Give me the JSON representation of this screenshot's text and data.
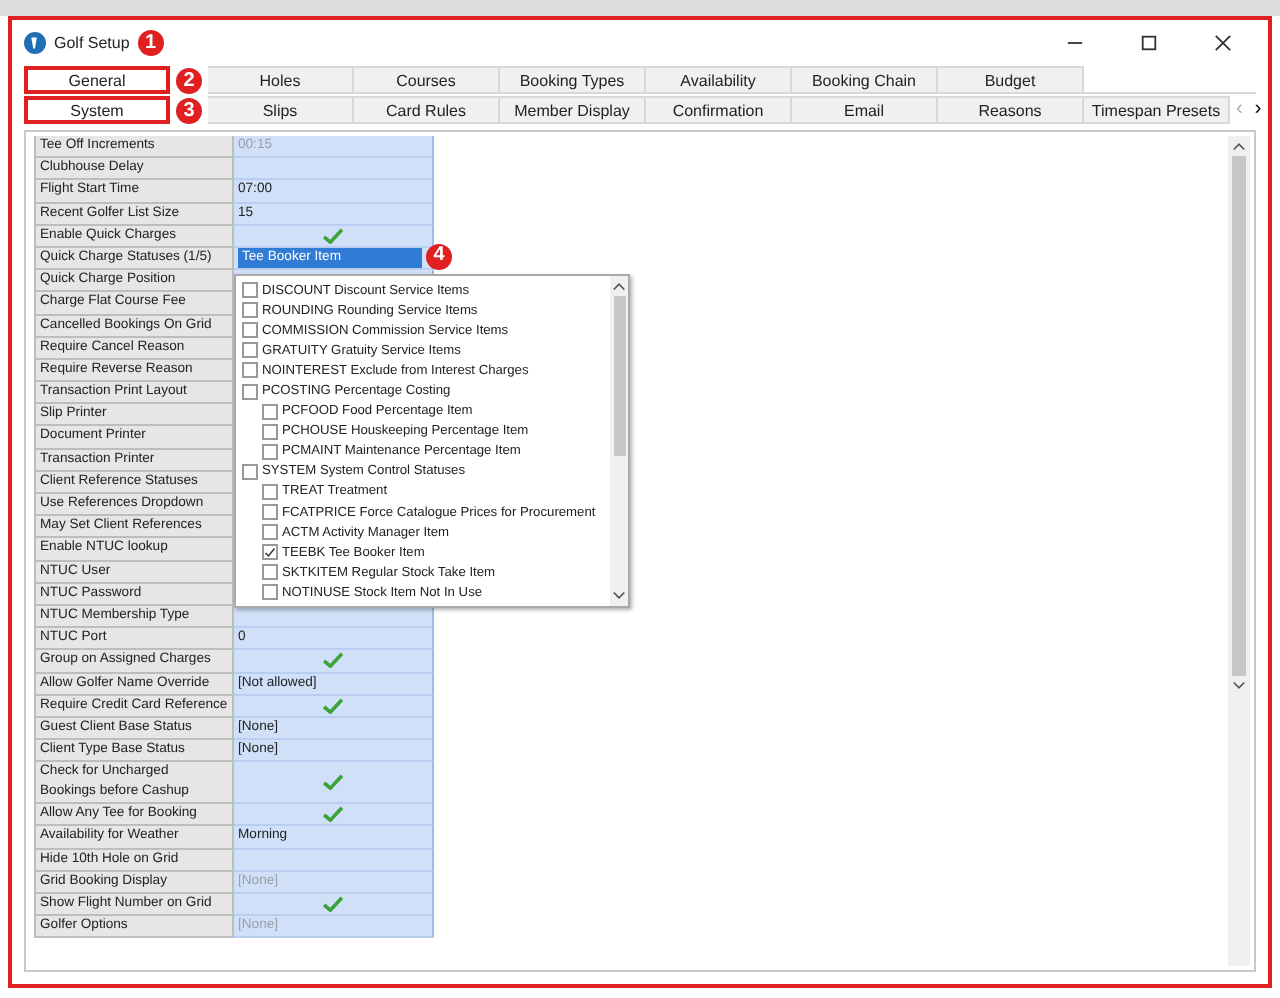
{
  "window": {
    "title": "Golf Setup",
    "badge": "1"
  },
  "tab_rows": [
    {
      "badge": "2",
      "tabs": [
        {
          "label": "General",
          "selected": true,
          "highlighted": true
        },
        {
          "label": "Holes",
          "selected": false,
          "highlighted": false
        },
        {
          "label": "Courses",
          "selected": false,
          "highlighted": false
        },
        {
          "label": "Booking Types",
          "selected": false,
          "highlighted": false
        },
        {
          "label": "Availability",
          "selected": false,
          "highlighted": false
        },
        {
          "label": "Booking Chain",
          "selected": false,
          "highlighted": false
        },
        {
          "label": "Budget",
          "selected": false,
          "highlighted": false
        }
      ]
    },
    {
      "badge": "3",
      "tabs": [
        {
          "label": "System",
          "selected": true,
          "highlighted": true
        },
        {
          "label": "Slips",
          "selected": false,
          "highlighted": false
        },
        {
          "label": "Card Rules",
          "selected": false,
          "highlighted": false
        },
        {
          "label": "Member Display",
          "selected": false,
          "highlighted": false
        },
        {
          "label": "Confirmation",
          "selected": false,
          "highlighted": false
        },
        {
          "label": "Email",
          "selected": false,
          "highlighted": false
        },
        {
          "label": "Reasons",
          "selected": false,
          "highlighted": false
        },
        {
          "label": "Timespan Presets",
          "selected": false,
          "highlighted": false
        }
      ]
    }
  ],
  "tab_scroll": {
    "left": "‹",
    "right": "›"
  },
  "grid": {
    "rows": [
      {
        "label": "Tee Off Increments",
        "kind": "text",
        "value": "00:15",
        "disabled": true
      },
      {
        "label": "Clubhouse Delay",
        "kind": "text"
      },
      {
        "label": "Flight Start Time",
        "kind": "text",
        "value": "07:00",
        "disabled": false
      },
      {
        "label": "Recent Golfer List Size",
        "kind": "text",
        "value": "15",
        "disabled": false
      },
      {
        "label": "Enable Quick Charges",
        "kind": "check",
        "checked": true
      },
      {
        "label": "Quick Charge Statuses (1/5)",
        "kind": "dropdown",
        "value": "Tee Booker Item",
        "badge": "4"
      },
      {
        "label": "Quick Charge Position",
        "kind": "text"
      },
      {
        "label": "Charge Flat Course Fee",
        "kind": "text"
      },
      {
        "label": "Cancelled Bookings On Grid",
        "kind": "text"
      },
      {
        "label": "Require Cancel Reason",
        "kind": "text"
      },
      {
        "label": "Require Reverse Reason",
        "kind": "text"
      },
      {
        "label": "Transaction Print Layout",
        "kind": "text"
      },
      {
        "label": "Slip Printer",
        "kind": "text"
      },
      {
        "label": "Document Printer",
        "kind": "text"
      },
      {
        "label": "Transaction Printer",
        "kind": "text"
      },
      {
        "label": "Client Reference Statuses",
        "kind": "text"
      },
      {
        "label": "Use References Dropdown",
        "kind": "text"
      },
      {
        "label": "May Set Client References",
        "kind": "text"
      },
      {
        "label": "Enable NTUC lookup",
        "kind": "text"
      },
      {
        "label": "NTUC User",
        "kind": "text"
      },
      {
        "label": "NTUC Password",
        "kind": "text"
      },
      {
        "label": "NTUC Membership Type",
        "kind": "text"
      },
      {
        "label": "NTUC Port",
        "kind": "text",
        "value": "0",
        "disabled": false
      },
      {
        "label": "Group on Assigned Charges",
        "kind": "check",
        "checked": true
      },
      {
        "label": "Allow Golfer Name Override",
        "kind": "text",
        "value": "[Not allowed]",
        "disabled": false
      },
      {
        "label": "Require Credit Card Reference",
        "kind": "check",
        "checked": true
      },
      {
        "label": "Guest Client Base Status",
        "kind": "text",
        "value": "[None]",
        "disabled": false
      },
      {
        "label": "Client Type Base Status",
        "kind": "text",
        "value": "[None]",
        "disabled": false
      },
      {
        "label": "Check for Uncharged Bookings before Cashup",
        "kind": "check",
        "checked": true
      },
      {
        "label": "Allow Any Tee for Booking",
        "kind": "check",
        "checked": true
      },
      {
        "label": "Availability for Weather",
        "kind": "text",
        "value": "Morning",
        "disabled": false
      },
      {
        "label": "Hide 10th Hole on Grid",
        "kind": "text"
      },
      {
        "label": "Grid Booking Display",
        "kind": "text",
        "value": "[None]",
        "disabled": true
      },
      {
        "label": "Show Flight Number on Grid",
        "kind": "check",
        "checked": true
      },
      {
        "label": "Golfer Options",
        "kind": "text",
        "value": "[None]",
        "disabled": true
      }
    ]
  },
  "dropdown_list": {
    "items": [
      {
        "label": "DISCOUNT Discount Service Items",
        "checked": false
      },
      {
        "label": "ROUNDING Rounding Service Items",
        "checked": false
      },
      {
        "label": "COMMISSION Commission Service Items",
        "checked": false
      },
      {
        "label": "GRATUITY Gratuity Service Items",
        "checked": false
      },
      {
        "label": "NOINTEREST Exclude from Interest Charges",
        "checked": false
      },
      {
        "label": "PCOSTING Percentage Costing",
        "checked": false,
        "children": [
          {
            "label": "PCFOOD Food Percentage Item",
            "checked": false
          },
          {
            "label": "PCHOUSE Houskeeping Percentage Item",
            "checked": false
          },
          {
            "label": "PCMAINT Maintenance Percentage Item",
            "checked": false
          }
        ]
      },
      {
        "label": "SYSTEM System Control Statuses",
        "checked": false,
        "children": [
          {
            "label": "TREAT Treatment",
            "checked": false
          },
          {
            "label": "FCATPRICE Force Catalogue Prices for Procurement",
            "checked": false
          },
          {
            "label": "ACTM Activity Manager Item",
            "checked": false
          },
          {
            "label": "TEEBK Tee Booker Item",
            "checked": true
          },
          {
            "label": "SKTKITEM Regular Stock Take Item",
            "checked": false
          },
          {
            "label": "NOTINUSE Stock Item Not In Use",
            "checked": false
          }
        ]
      }
    ]
  }
}
